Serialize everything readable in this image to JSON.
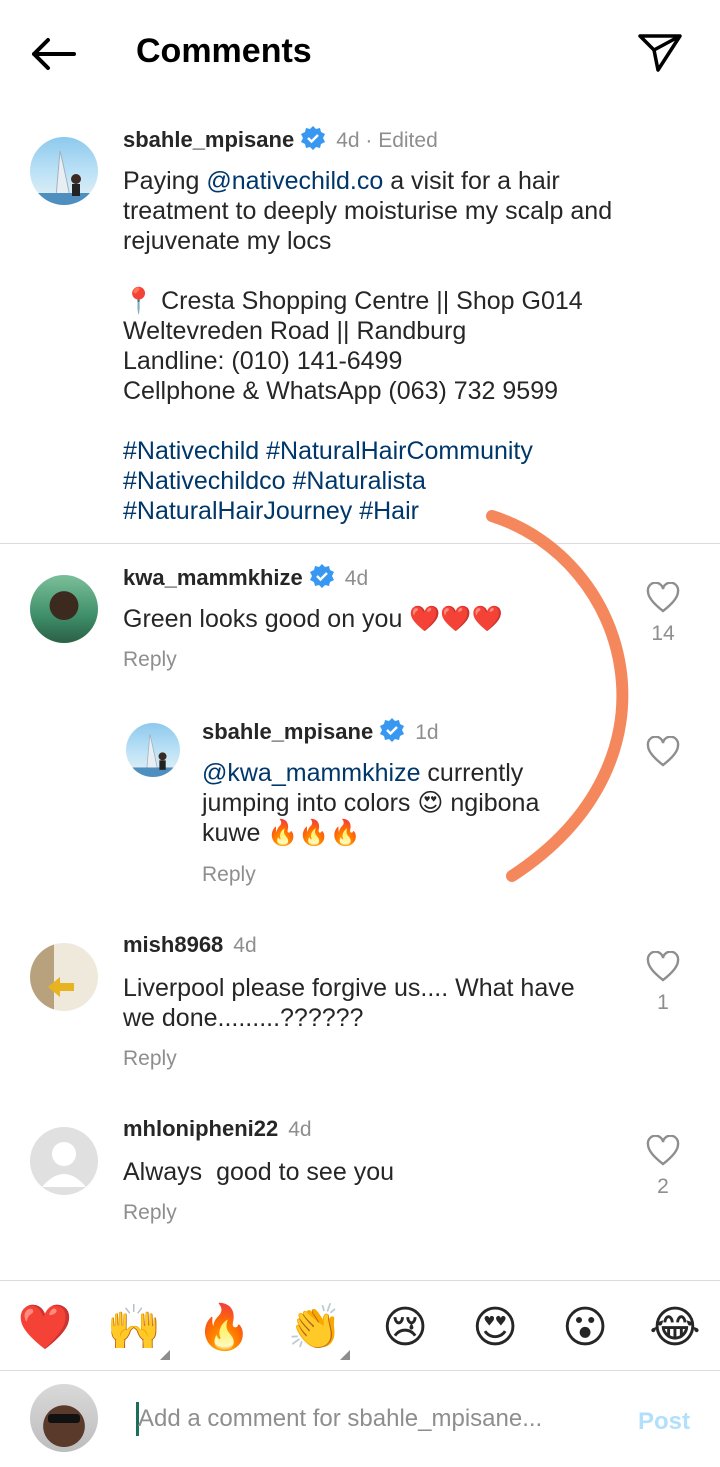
{
  "header": {
    "title": "Comments",
    "back_icon": "arrow-left-icon",
    "share_icon": "paper-plane-icon"
  },
  "caption": {
    "username": "sbahle_mpisane",
    "meta": "4d · Edited",
    "line1_pre": "Paying ",
    "line1_mention": "@nativechild.co",
    "line1_post": " a visit for a hair",
    "line2": "treatment to deeply moisturise my scalp and",
    "line3": "rejuvenate my locs",
    "location_pin": "📍",
    "line4": " Cresta Shopping Centre || Shop G014",
    "line5": "Weltevreden Road || Randburg",
    "line6": "Landline: (010) 141-6499",
    "line7": "Cellphone & WhatsApp (063) 732 9599",
    "tags1": "#Nativechild #NaturalHairCommunity",
    "tags2": "#Nativechildco #Naturalista",
    "tags3": "#NaturalHairJourney #Hair"
  },
  "comments": [
    {
      "username": "kwa_mammkhize",
      "time": "4d",
      "text": "Green looks good on you ❤️❤️❤️",
      "reply": "Reply",
      "likes": "14"
    },
    {
      "username": "sbahle_mpisane",
      "time": "1d",
      "mention": "@kwa_mammkhize",
      "text1": " currently",
      "text2": "jumping into colors 😍 ngibona",
      "text3": "kuwe 🔥🔥🔥",
      "reply": "Reply"
    },
    {
      "username": "mish8968",
      "time": "4d",
      "text1": "Liverpool please forgive us.... What have",
      "text2": "we done.........??????",
      "reply": "Reply",
      "likes": "1"
    },
    {
      "username": "mhlonipheni22",
      "time": "4d",
      "text": "Always  good to see you",
      "reply": "Reply",
      "likes": "2"
    }
  ],
  "emoji_bar": [
    "❤️",
    "🙌",
    "🔥",
    "👏",
    "😢",
    "😍",
    "😮",
    "😂"
  ],
  "composer": {
    "placeholder": "Add a comment for sbahle_mpisane...",
    "post_label": "Post"
  },
  "colors": {
    "link": "#00376b",
    "verified": "#3897f0",
    "annotation": "#f47a4a",
    "post_disabled": "#b2dffc"
  }
}
